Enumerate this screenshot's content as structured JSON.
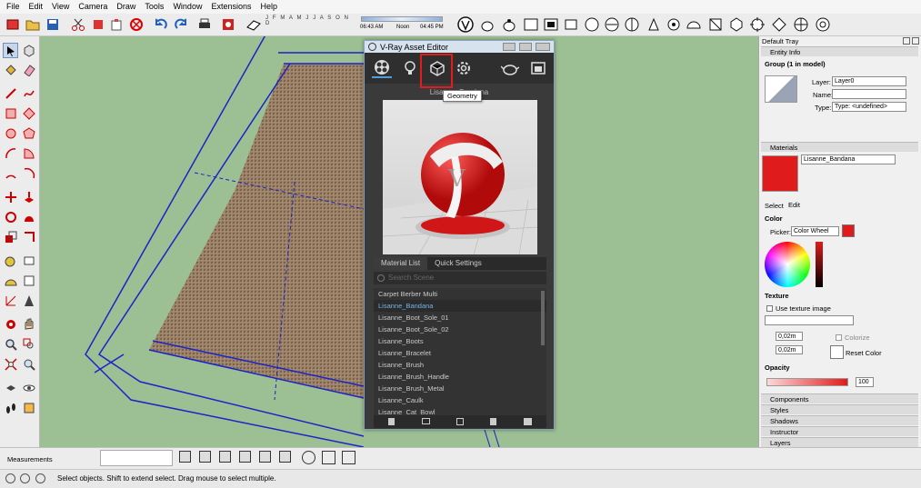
{
  "menu": [
    "File",
    "Edit",
    "View",
    "Camera",
    "Draw",
    "Tools",
    "Window",
    "Extensions",
    "Help"
  ],
  "shadow_timeline": {
    "time_left": "06:43 AM",
    "noon": "Noon",
    "time_right": "04:45 PM",
    "months": "J F M A M J J A S O N D"
  },
  "vray": {
    "title": "V-Ray Asset Editor",
    "material_name": "Lisanne_Bandana",
    "tooltip": "Geometry",
    "tabs": [
      "Material List",
      "Quick Settings"
    ],
    "search_placeholder": "Search Scene",
    "materials": [
      "Carpet Berber Multi",
      "Lisanne_Bandana",
      "Lisanne_Boot_Sole_01",
      "Lisanne_Boot_Sole_02",
      "Lisanne_Boots",
      "Lisanne_Bracelet",
      "Lisanne_Brush",
      "Lisanne_Brush_Handle",
      "Lisanne_Brush_Metal",
      "Lisanne_Caulk",
      "Lisanne_Cat_Bowl"
    ],
    "selected_index": 1
  },
  "tray": {
    "title": "Default Tray",
    "entity_info": {
      "header": "Entity Info",
      "group": "Group (1 in model)",
      "layer_label": "Layer:",
      "layer_value": "Layer0",
      "name_label": "Name:",
      "name_value": "",
      "type_label": "Type:",
      "type_value": "Type: <undefined>"
    },
    "materials": {
      "header": "Materials",
      "name": "Lisanne_Bandana",
      "swatch": "#e01b1b",
      "tab_select": "Select",
      "tab_edit": "Edit",
      "color_label": "Color",
      "picker_label": "Picker:",
      "picker_value": "Color Wheel",
      "texture_label": "Texture",
      "use_texture": "Use texture image",
      "dim1": "0,02m",
      "dim2": "0,02m",
      "colorize": "Colorize",
      "reset_color": "Reset Color",
      "opacity_label": "Opacity",
      "opacity_value": "100"
    },
    "collapsed": [
      "Components",
      "Styles",
      "Shadows",
      "Instructor",
      "Layers"
    ]
  },
  "measurements_label": "Measurements",
  "status_text": "Select objects. Shift to extend select. Drag mouse to select multiple."
}
